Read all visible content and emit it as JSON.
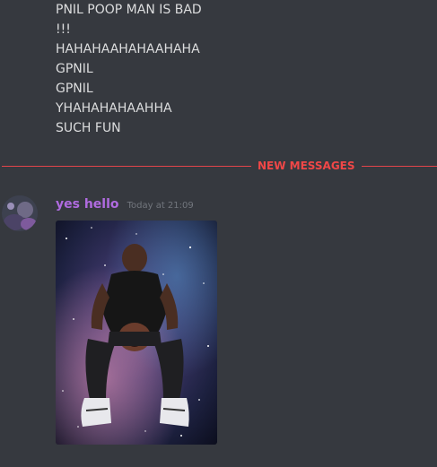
{
  "previous_messages": [
    "PNIL POOP MAN IS BAD",
    "!!!",
    "HAHAHAAHAHAAHAHA",
    "GPNIL",
    "GPNIL",
    "YHAHAHAHAAHHA",
    "SUCH FUN"
  ],
  "divider": {
    "label": "NEW MESSAGES",
    "color": "#f04747"
  },
  "message": {
    "author": "yes hello",
    "author_color": "#b06be0",
    "timestamp": "Today at 21:09",
    "attachment_icon": "image-attachment-icon"
  },
  "colors": {
    "background": "#36393f",
    "text": "#dcddde",
    "muted": "#72767d"
  }
}
